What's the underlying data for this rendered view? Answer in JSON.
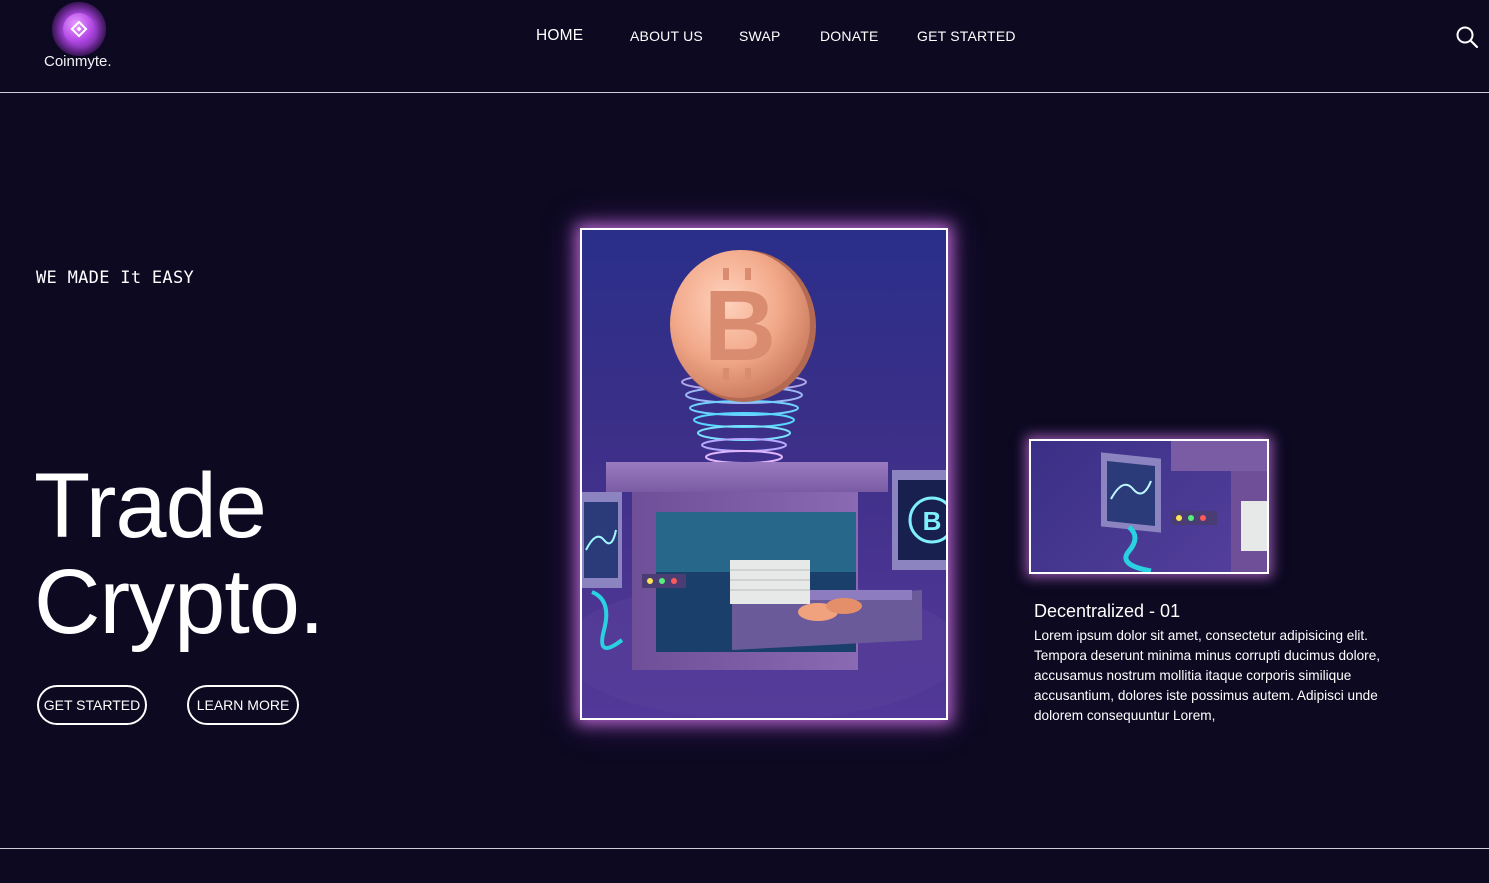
{
  "brand": {
    "name": "Coinmyte.",
    "logo_icon": "binance-diamond-icon",
    "accent": "#b64de8"
  },
  "nav": {
    "items": [
      {
        "label": "HOME"
      },
      {
        "label": "ABOUT US"
      },
      {
        "label": "SWAP"
      },
      {
        "label": "DONATE"
      },
      {
        "label": "GET STARTED"
      }
    ],
    "search_icon": "search-icon"
  },
  "hero": {
    "tagline": "WE MADE It EASY",
    "headline_line1": "Trade",
    "headline_line2": "Crypto.",
    "primary_button": "GET STARTED",
    "secondary_button": "LEARN MORE",
    "image_subject": "bitcoin-mining-machine-illustration"
  },
  "feature": {
    "title": "Decentralized - 01",
    "text": "Lorem ipsum dolor sit amet, consectetur adipisicing elit. Tempora deserunt minima minus corrupti ducimus dolore, accusamus nostrum mollitia itaque corporis similique accusantium, dolores iste possimus autem. Adipisci unde dolorem consequuntur Lorem,"
  },
  "colors": {
    "background": "#0c0921",
    "glow": "#d478eb",
    "text": "#ffffff"
  }
}
